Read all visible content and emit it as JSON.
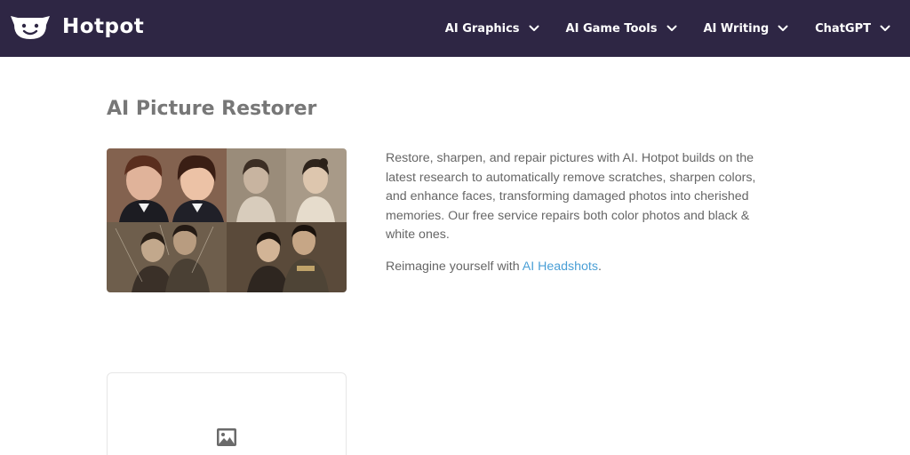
{
  "brand": {
    "name": "Hotpot"
  },
  "nav": {
    "items": [
      {
        "label": "AI Graphics",
        "icon": "chevron-down-icon"
      },
      {
        "label": "AI Game Tools",
        "icon": "chevron-down-icon"
      },
      {
        "label": "AI Writing",
        "icon": "chevron-down-icon"
      },
      {
        "label": "ChatGPT",
        "icon": "chevron-down-icon"
      }
    ]
  },
  "main": {
    "title": "AI Picture Restorer",
    "description": "Restore, sharpen, and repair pictures with AI. Hotpot builds on the latest research to automatically remove scratches, sharpen colors, and enhance faces, transforming damaged photos into cherished memories. Our free service repairs both color photos and black & white ones.",
    "reimagine_prefix": "Reimagine yourself with ",
    "reimagine_link": "AI Headshots",
    "reimagine_suffix": "."
  },
  "upload": {
    "icon": "image-icon"
  },
  "colors": {
    "header_bg": "#2e2644",
    "link": "#4a9fd6",
    "title": "#777777"
  }
}
